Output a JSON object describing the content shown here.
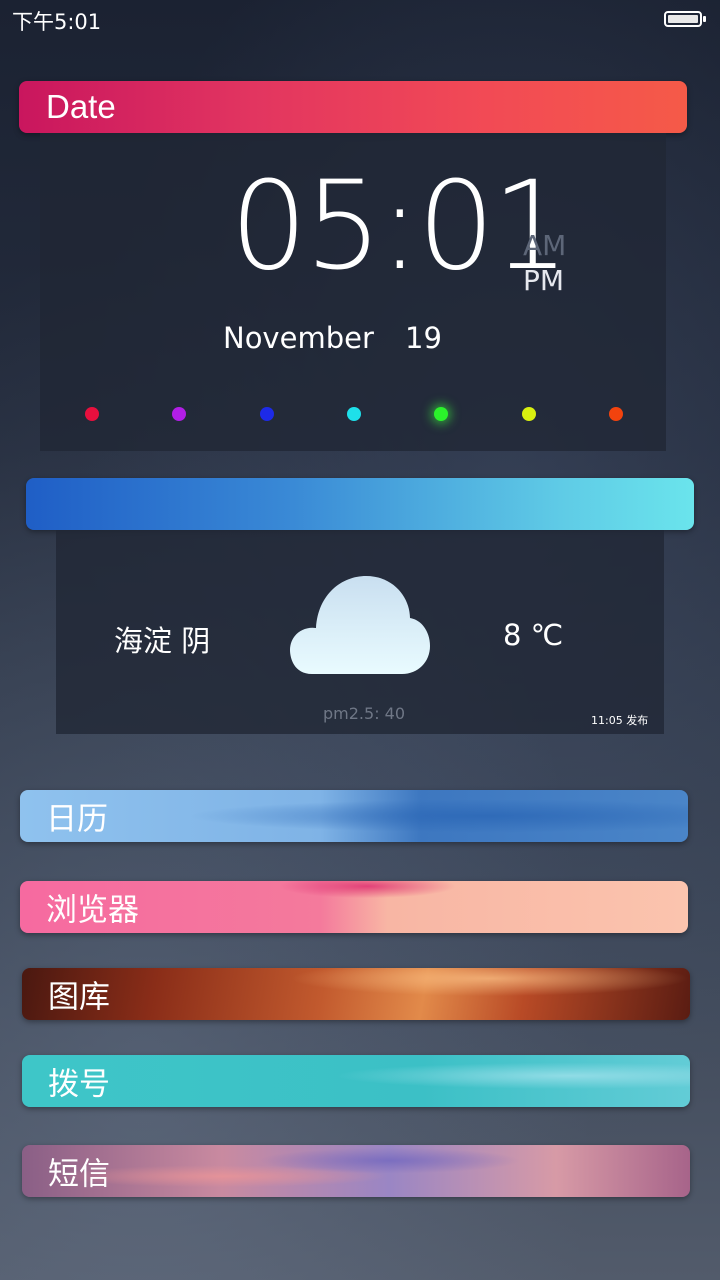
{
  "status_bar": {
    "time": "下午5:01",
    "battery_icon": "battery-icon"
  },
  "date_widget": {
    "banner_label": "Date",
    "time": "05:01",
    "am": "AM",
    "pm": "PM",
    "month": "November",
    "day": "19",
    "dot_colors": [
      "#e8103e",
      "#b21ee6",
      "#1d2ae8",
      "#1ee0ea",
      "#2bf22b",
      "#d9f010",
      "#f2430e"
    ]
  },
  "weather_widget": {
    "location": "海淀 阴",
    "temperature": "8 ℃",
    "pm25": "pm2.5: 40",
    "publish_time": "11:05 发布",
    "icon": "cloud-icon"
  },
  "apps": [
    {
      "label": "日历"
    },
    {
      "label": "浏览器"
    },
    {
      "label": "图库"
    },
    {
      "label": "拨号"
    },
    {
      "label": "短信"
    }
  ]
}
